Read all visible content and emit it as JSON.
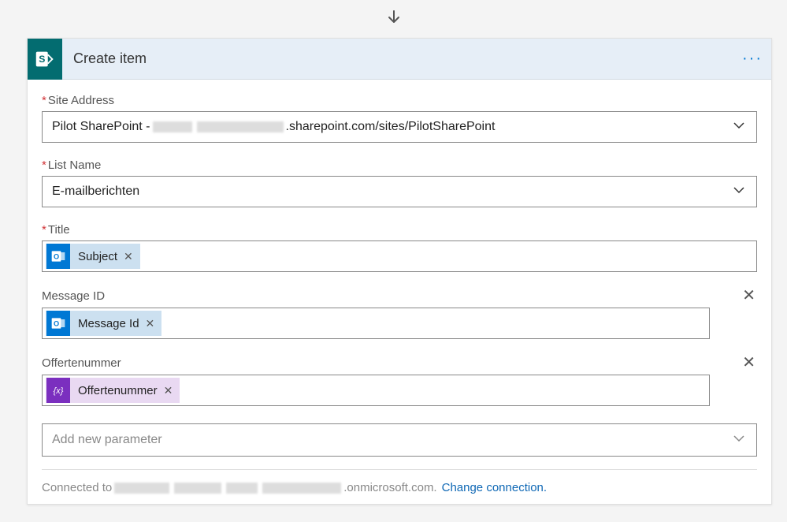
{
  "header": {
    "title": "Create item"
  },
  "fields": {
    "siteAddress": {
      "label": "Site Address",
      "valuePrefix": "Pilot SharePoint - ",
      "valueSuffix": ".sharepoint.com/sites/PilotSharePoint"
    },
    "listName": {
      "label": "List Name",
      "value": "E-mailberichten"
    },
    "title": {
      "label": "Title",
      "tokenText": "Subject"
    },
    "messageId": {
      "label": "Message ID",
      "tokenText": "Message Id"
    },
    "offertenummer": {
      "label": "Offertenummer",
      "tokenText": "Offertenummer"
    }
  },
  "addParam": {
    "placeholder": "Add new parameter"
  },
  "footer": {
    "connectedPrefix": "Connected to ",
    "connectedSuffix": ".onmicrosoft.com.",
    "changeLink": "Change connection."
  }
}
